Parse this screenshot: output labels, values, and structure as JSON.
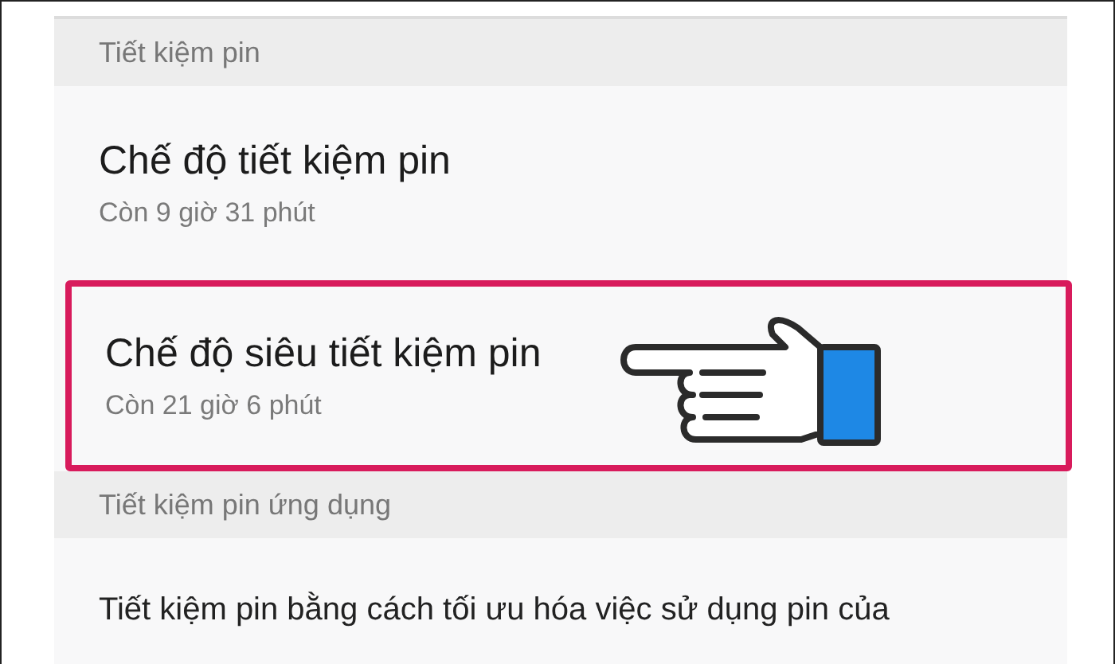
{
  "sections": [
    {
      "header": "Tiết kiệm pin",
      "items": [
        {
          "kind": "option",
          "title": "Chế độ tiết kiệm pin",
          "subtitle": "Còn 9 giờ 31 phút",
          "highlighted": false
        },
        {
          "kind": "option",
          "title": "Chế độ siêu tiết kiệm pin",
          "subtitle": "Còn 21 giờ 6 phút",
          "highlighted": true
        }
      ]
    },
    {
      "header": "Tiết kiệm pin ứng dụng",
      "items": [
        {
          "kind": "description",
          "text": "Tiết kiệm pin bằng cách tối ưu hóa việc sử dụng pin của"
        }
      ]
    }
  ]
}
